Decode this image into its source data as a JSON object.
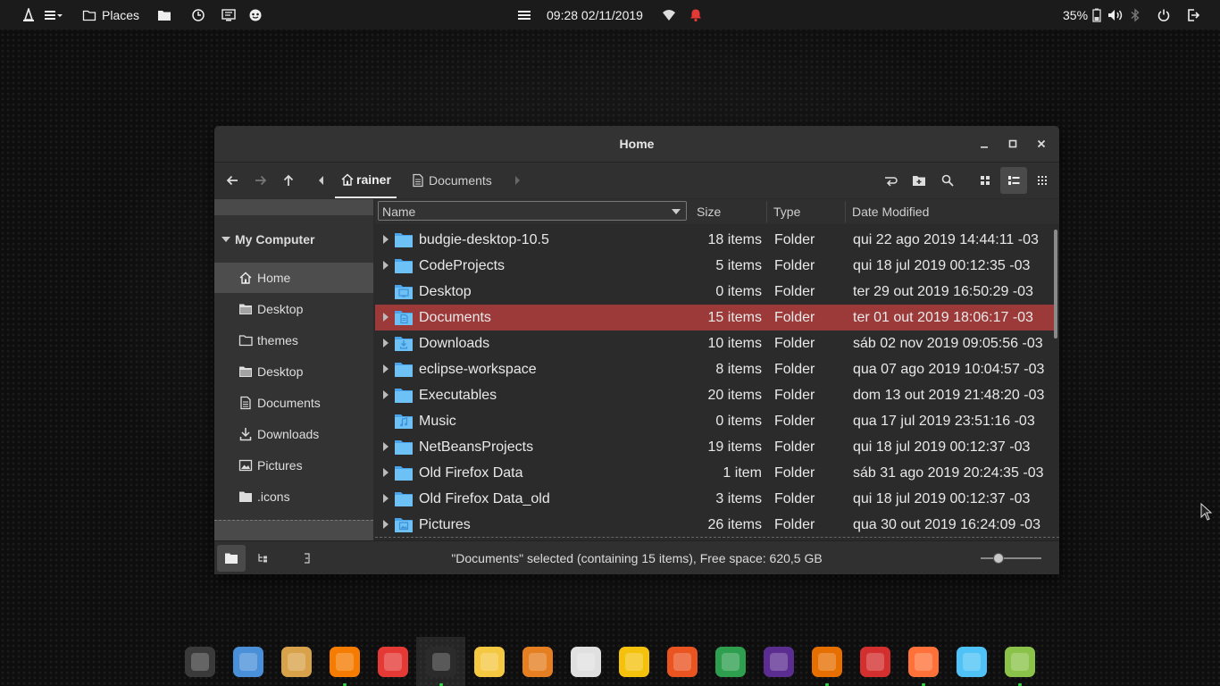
{
  "top_panel": {
    "places_label": "Places",
    "clock": "09:28 02/11/2019",
    "battery": "35%"
  },
  "window": {
    "title": "Home",
    "breadcrumbs": [
      "rainer",
      "Documents"
    ]
  },
  "sidebar": {
    "header": "My Computer",
    "items": [
      {
        "label": "Home",
        "icon": "home-icon",
        "selected": true
      },
      {
        "label": "Desktop",
        "icon": "folder-icon"
      },
      {
        "label": "themes",
        "icon": "folder-outline-icon"
      },
      {
        "label": "Desktop",
        "icon": "folder-icon"
      },
      {
        "label": "Documents",
        "icon": "document-icon"
      },
      {
        "label": "Downloads",
        "icon": "download-icon"
      },
      {
        "label": "Pictures",
        "icon": "picture-icon"
      },
      {
        "label": ".icons",
        "icon": "folder-icon"
      }
    ]
  },
  "columns": {
    "name": "Name",
    "size": "Size",
    "type": "Type",
    "date": "Date Modified"
  },
  "files": [
    {
      "name": "budgie-desktop-10.5",
      "size": "18 items",
      "type": "Folder",
      "date": "qui 22 ago 2019 14:44:11 -03",
      "expandable": true,
      "icon": "folder"
    },
    {
      "name": "CodeProjects",
      "size": "5 items",
      "type": "Folder",
      "date": "qui 18 jul 2019 00:12:35 -03",
      "expandable": true,
      "icon": "folder"
    },
    {
      "name": "Desktop",
      "size": "0 items",
      "type": "Folder",
      "date": "ter 29 out 2019 16:50:29 -03",
      "expandable": false,
      "icon": "desktop"
    },
    {
      "name": "Documents",
      "size": "15 items",
      "type": "Folder",
      "date": "ter 01 out 2019 18:06:17 -03",
      "expandable": true,
      "icon": "documents",
      "selected": true
    },
    {
      "name": "Downloads",
      "size": "10 items",
      "type": "Folder",
      "date": "sáb 02 nov 2019 09:05:56 -03",
      "expandable": true,
      "icon": "downloads"
    },
    {
      "name": "eclipse-workspace",
      "size": "8 items",
      "type": "Folder",
      "date": "qua 07 ago 2019 10:04:57 -03",
      "expandable": true,
      "icon": "folder"
    },
    {
      "name": "Executables",
      "size": "20 items",
      "type": "Folder",
      "date": "dom 13 out 2019 21:48:20 -03",
      "expandable": true,
      "icon": "folder"
    },
    {
      "name": "Music",
      "size": "0 items",
      "type": "Folder",
      "date": "qua 17 jul 2019 23:51:16 -03",
      "expandable": false,
      "icon": "music"
    },
    {
      "name": "NetBeansProjects",
      "size": "19 items",
      "type": "Folder",
      "date": "qui 18 jul 2019 00:12:37 -03",
      "expandable": true,
      "icon": "folder"
    },
    {
      "name": "Old Firefox Data",
      "size": "1 item",
      "type": "Folder",
      "date": "sáb 31 ago 2019 20:24:35 -03",
      "expandable": true,
      "icon": "folder"
    },
    {
      "name": "Old Firefox Data_old",
      "size": "3 items",
      "type": "Folder",
      "date": "qui 18 jul 2019 00:12:37 -03",
      "expandable": true,
      "icon": "folder"
    },
    {
      "name": "Pictures",
      "size": "26 items",
      "type": "Folder",
      "date": "qua 30 out 2019 16:24:09 -03",
      "expandable": true,
      "icon": "pictures"
    }
  ],
  "status": {
    "text": "\"Documents\" selected (containing 15 items), Free space: 620,5 GB",
    "zoom_level": 0.3
  },
  "dock": {
    "apps": [
      {
        "name": "vpn-app-icon",
        "color": "#3a3a3a",
        "running": false
      },
      {
        "name": "music-player-icon",
        "color": "#4a90d9",
        "running": false
      },
      {
        "name": "spreadsheet-app-icon",
        "color": "#d8a24a",
        "running": false
      },
      {
        "name": "audio-player-icon",
        "color": "#f57c00",
        "running": true
      },
      {
        "name": "pdf-viewer-icon",
        "color": "#e53935",
        "running": false
      },
      {
        "name": "file-manager-icon",
        "color": "#2b2b2b",
        "running": true
      },
      {
        "name": "mail-app-icon",
        "color": "#f5c842",
        "running": false
      },
      {
        "name": "krita-icon",
        "color": "#e67e22",
        "running": false
      },
      {
        "name": "trash-icon",
        "color": "#e0e0e0",
        "running": false
      },
      {
        "name": "favorites-star-icon",
        "color": "#f4c20d",
        "running": false
      },
      {
        "name": "ubuntu-folder-icon",
        "color": "#e95420",
        "running": false
      },
      {
        "name": "sheets-app-icon",
        "color": "#2e9e4f",
        "running": false
      },
      {
        "name": "visual-studio-icon",
        "color": "#5c2d91",
        "running": false
      },
      {
        "name": "java-icon",
        "color": "#e76f00",
        "running": true
      },
      {
        "name": "typora-icon",
        "color": "#d32f2f",
        "running": false
      },
      {
        "name": "firefox-icon",
        "color": "#ff7139",
        "running": true
      },
      {
        "name": "archive-manager-icon",
        "color": "#4fc3f7",
        "running": false
      },
      {
        "name": "android-app-icon",
        "color": "#8bc34a",
        "running": true
      }
    ]
  }
}
